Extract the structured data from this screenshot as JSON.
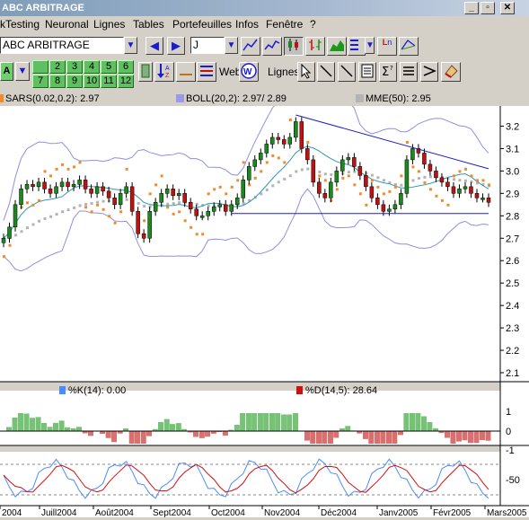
{
  "window": {
    "title": "ABC ARBITRAGE"
  },
  "menu": {
    "items": [
      "kTesting",
      "Neuronal",
      "Lignes",
      "Tables",
      "Portefeuilles",
      "Infos",
      "Fenêtre",
      "?"
    ]
  },
  "toolbar": {
    "symbol_value": "ABC ARBITRAGE",
    "period_value": "J",
    "zoom_label": "A",
    "number_buttons": [
      "2",
      "3",
      "4",
      "5",
      "6",
      "7",
      "8",
      "9",
      "10",
      "11",
      "12"
    ],
    "web_label": "Web",
    "lines_label": "Lignes"
  },
  "legend_main": {
    "sars": "SARS(0.02,0.2):  2.97",
    "boll": "BOLL(20,2):  2.97/  2.89",
    "mme": "MME(50):  2.95",
    "sars_color": "#f08a2a",
    "boll_color": "#9a9ae8",
    "mme_color": "#b4b4b4"
  },
  "legend_osc": {
    "k": "%K(14):  0.00",
    "d": "%D(14,5): 28.64",
    "k_color": "#4a8cff",
    "d_color": "#d01010"
  },
  "chart_data": {
    "type": "line",
    "title": "",
    "x_labels": [
      "2004",
      "Juill2004",
      "Août2004",
      "Sept2004",
      "Oct2004",
      "Nov2004",
      "Déc2004",
      "Janv2005",
      "Févr2005",
      "Mars2005"
    ],
    "y_ticks": [
      "3.2",
      "3.1",
      "3.0",
      "2.9",
      "2.8",
      "2.7",
      "2.6",
      "2.5",
      "2.4",
      "2.3",
      "2.2",
      "2.1"
    ],
    "ylim": [
      2.08,
      3.27
    ],
    "osc_ticks": [
      "1",
      "0",
      "-1"
    ],
    "rsi_ticks": [
      "-50"
    ],
    "series": [
      {
        "name": "",
        "values": [
          2.7,
          2.75,
          2.85,
          2.92,
          2.94,
          2.93,
          2.95,
          2.92,
          2.9,
          2.93,
          2.95,
          2.93,
          2.94,
          2.96,
          2.92,
          2.9,
          2.93,
          2.91,
          2.88,
          2.85,
          2.9,
          2.93,
          2.82,
          2.72,
          2.7,
          2.82,
          2.86,
          2.9,
          2.92,
          2.89,
          2.9,
          2.86,
          2.83,
          2.8,
          2.8,
          2.82,
          2.84,
          2.85,
          2.82,
          2.85,
          2.88,
          2.96,
          3.02,
          3.05,
          3.08,
          3.12,
          3.15,
          3.14,
          3.12,
          3.15,
          3.22,
          3.1,
          3.05,
          2.95,
          2.9,
          2.88,
          2.95,
          3.0,
          3.05,
          3.06,
          3.02,
          2.98,
          2.93,
          2.88,
          2.85,
          2.82,
          2.83,
          2.85,
          2.9,
          3.05,
          3.1,
          3.08,
          3.03,
          3.0,
          2.97,
          2.95,
          2.93,
          2.9,
          2.92,
          2.93,
          2.9,
          2.88,
          2.88,
          2.86
        ]
      }
    ],
    "resistance_line": {
      "from": [
        50,
        3.25
      ],
      "to": [
        83,
        3.01
      ]
    },
    "support_line": {
      "from": [
        42,
        2.81
      ],
      "to": [
        83,
        2.81
      ]
    }
  }
}
